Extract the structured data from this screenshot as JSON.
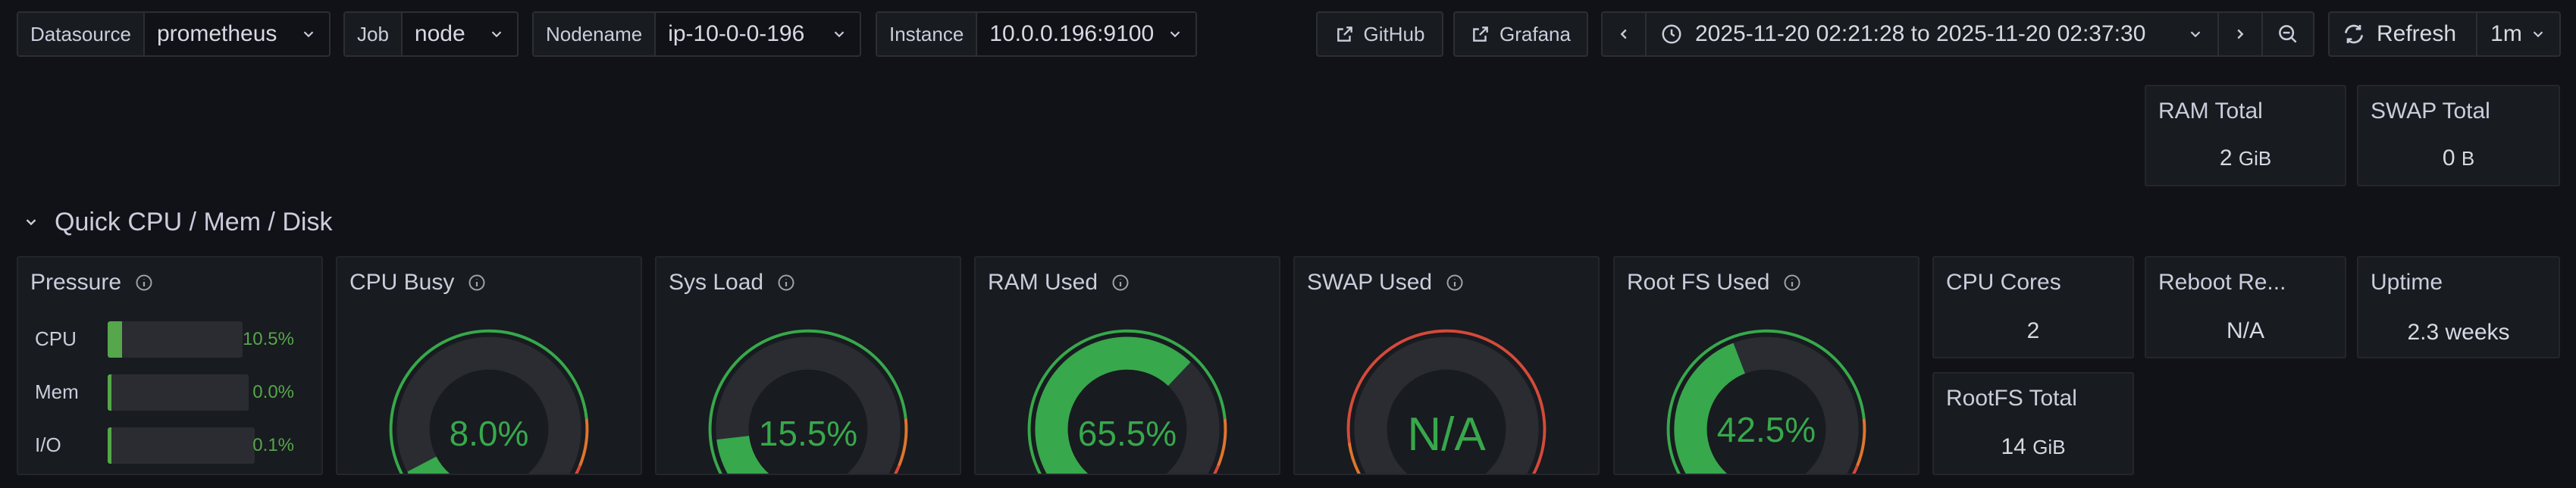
{
  "variables": [
    {
      "label": "Datasource",
      "value": "prometheus"
    },
    {
      "label": "Job",
      "value": "node"
    },
    {
      "label": "Nodename",
      "value": "ip-10-0-0-196"
    },
    {
      "label": "Instance",
      "value": "10.0.0.196:9100"
    }
  ],
  "links": {
    "github": "GitHub",
    "grafana": "Grafana"
  },
  "time_range": "2025-11-20 02:21:28 to 2025-11-20 02:37:30",
  "refresh": {
    "label": "Refresh",
    "interval": "1m"
  },
  "row": {
    "title": "Quick CPU / Mem / Disk"
  },
  "stats": {
    "ram_total": {
      "title": "RAM Total",
      "value": "2",
      "unit": "GiB"
    },
    "swap_total": {
      "title": "SWAP Total",
      "value": "0",
      "unit": "B"
    },
    "cpu_cores": {
      "title": "CPU Cores",
      "value": "2"
    },
    "reboot": {
      "title": "Reboot Re...",
      "value": "N/A"
    },
    "uptime": {
      "title": "Uptime",
      "value": "2.3 weeks"
    },
    "rootfs_total": {
      "title": "RootFS Total",
      "value": "14",
      "unit": "GiB"
    }
  },
  "pressure": {
    "title": "Pressure",
    "rows": [
      {
        "label": "CPU",
        "value": "10.5%",
        "fraction": 0.105
      },
      {
        "label": "Mem",
        "value": "0.0%",
        "fraction": 0.0
      },
      {
        "label": "I/O",
        "value": "0.1%",
        "fraction": 0.001
      }
    ]
  },
  "gauges": [
    {
      "title": "CPU Busy",
      "text": "8.0%",
      "fraction": 0.08
    },
    {
      "title": "Sys Load",
      "text": "15.5%",
      "fraction": 0.155
    },
    {
      "title": "RAM Used",
      "text": "65.5%",
      "fraction": 0.655
    },
    {
      "title": "SWAP Used",
      "text": "N/A",
      "fraction": null
    },
    {
      "title": "Root FS Used",
      "text": "42.5%",
      "fraction": 0.425
    }
  ],
  "colors": {
    "background": "#111217",
    "panel": "#181b1f",
    "green": "#37a84c",
    "orange": "#e0752d",
    "red": "#d44a3a",
    "track": "#2a2c31"
  }
}
